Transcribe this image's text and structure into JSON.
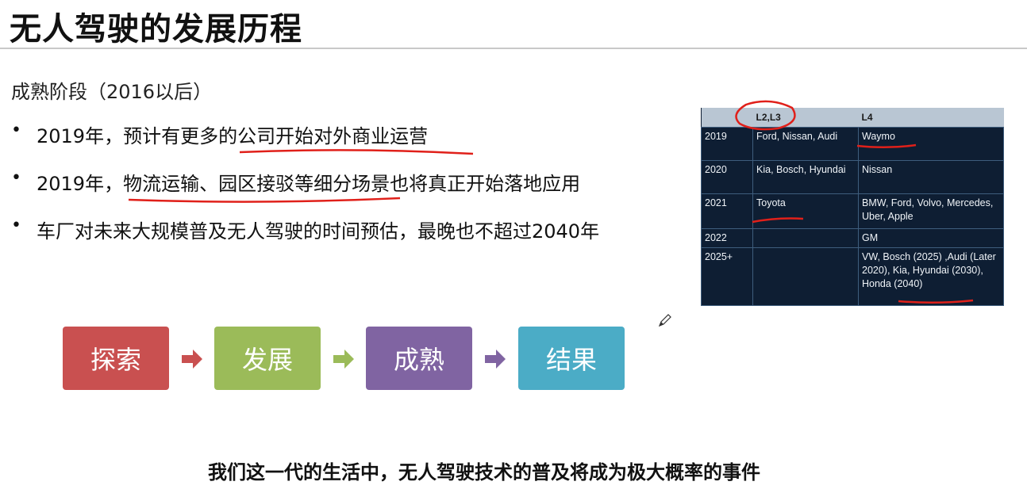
{
  "slide": {
    "title": "无人驾驶的发展历程",
    "subtitle": "成熟阶段（2016以后）",
    "bullets": [
      "2019年，预计有更多的公司开始对外商业运营",
      "2019年，物流运输、园区接驳等细分场景也将真正开始落地应用",
      "车厂对未来大规模普及无人驾驶的时间预估，最晚也不超过2040年"
    ],
    "bullet_marker": "•",
    "footer": "我们这一代的生活中，无人驾驶技术的普及将成为极大概率的事件"
  },
  "table": {
    "headers": [
      "",
      "L2,L3",
      "L4"
    ],
    "rows": [
      {
        "year": "2019",
        "l23": "Ford, Nissan, Audi",
        "l4": "Waymo"
      },
      {
        "year": "2020",
        "l23": "Kia, Bosch, Hyundai",
        "l4": "Nissan"
      },
      {
        "year": "2021",
        "l23": "Toyota",
        "l4": "BMW, Ford, Volvo, Mercedes, Uber, Apple"
      },
      {
        "year": "2022",
        "l23": "",
        "l4": "GM"
      },
      {
        "year": "2025+",
        "l23": "",
        "l4": "VW, Bosch (2025) ,Audi (Later 2020), Kia, Hyundai (2030), Honda (2040)"
      }
    ]
  },
  "stages": [
    {
      "label": "探索",
      "color": "#c95050"
    },
    {
      "label": "发展",
      "color": "#9bbb59"
    },
    {
      "label": "成熟",
      "color": "#8064a2"
    },
    {
      "label": "结果",
      "color": "#4bacc6"
    }
  ],
  "colors": {
    "annotation_red": "#e0201a",
    "table_bg": "#0e1e33",
    "table_header_bg": "#b9c6d3"
  },
  "icons": {
    "arrow": "right-arrow-icon",
    "pencil": "pencil-cursor-icon"
  }
}
